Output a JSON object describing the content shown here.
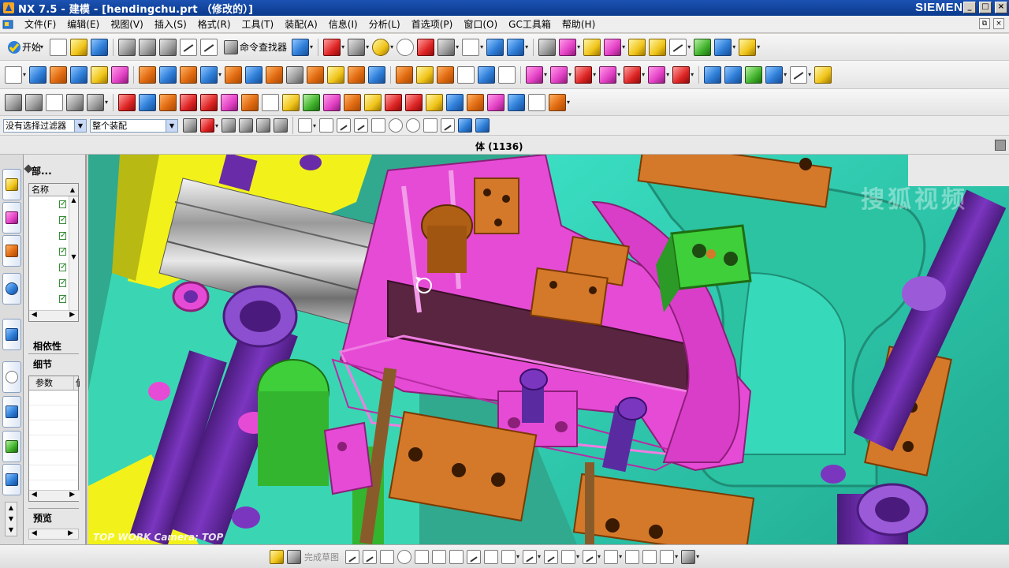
{
  "window": {
    "title": "NX 7.5 - 建模 - [hendingchu.prt （修改的）]",
    "brand": "SIEMENS",
    "controls": [
      "_",
      "□",
      "×"
    ]
  },
  "menu": {
    "items": [
      "文件(F)",
      "编辑(E)",
      "视图(V)",
      "插入(S)",
      "格式(R)",
      "工具(T)",
      "装配(A)",
      "信息(I)",
      "分析(L)",
      "首选项(P)",
      "窗口(O)",
      "GC工具箱",
      "帮助(H)"
    ]
  },
  "toolbar1": {
    "start_label": "开始",
    "command_finder_label": "命令查找器"
  },
  "selection_bar": {
    "filter_value": "没有选择过滤器",
    "scope_value": "整个装配"
  },
  "cue_line": {
    "text": "体 (1136)"
  },
  "navigator": {
    "title": "部...",
    "name_column": "名称",
    "dependencies_label": "相依性",
    "details_label": "细节",
    "parameters_column": "参数",
    "value_column": "值",
    "preview_label": "预览",
    "rows": 7
  },
  "viewport": {
    "view_label": "TOP WORK Camera: TOP",
    "watermark": "搜狐视频"
  },
  "bottom_bar": {
    "finish_sketch_label": "完成草图"
  },
  "colors": {
    "title_bar": "#1c52b3",
    "mold_cyan": "#2fd3b2",
    "slider_magenta": "#e64bd6",
    "pin_purple": "#6a2ba8",
    "block_orange": "#d4782a",
    "plate_yellow": "#f2f21a",
    "bolt_green": "#3ecf3a"
  }
}
